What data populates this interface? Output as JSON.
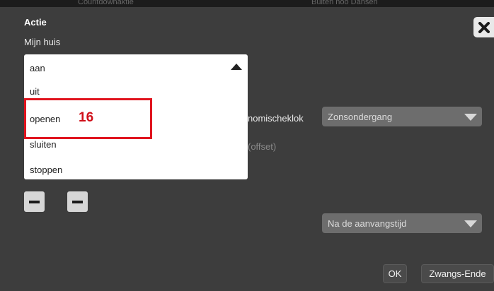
{
  "background_header": {
    "left_fragment": "Countdownaktie",
    "right_fragment": "Buiten noo Dansen"
  },
  "dialog": {
    "title": "Actie",
    "subtitle": "Mijn huis"
  },
  "action_dropdown": {
    "selected": "aan",
    "options": [
      "uit",
      "openen",
      "sluiten",
      "stoppen"
    ]
  },
  "annotation": {
    "badge": "16",
    "color": "#e0141e"
  },
  "astro": {
    "label_clock": "nomischeklok",
    "label_offset": "(offset)",
    "select_value": "Zonsondergang"
  },
  "timing": {
    "select_value": "Na de aanvangstijd"
  },
  "footer": {
    "ok_label": "OK",
    "force_end_label": "Zwangs-Ende"
  },
  "colors": {
    "dialog_bg": "#3d3d3d",
    "select_bg": "#6d6d6d"
  }
}
